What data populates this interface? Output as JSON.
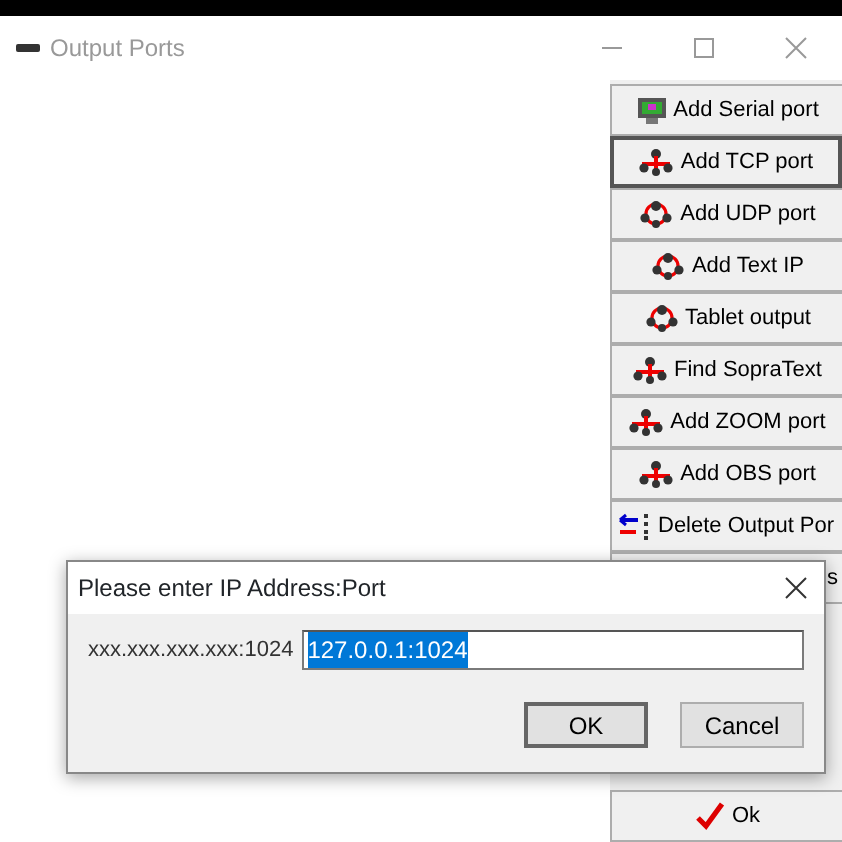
{
  "window": {
    "title": "Output Ports",
    "active": false
  },
  "buttons": [
    {
      "label": "Add Serial port",
      "kind": "serial",
      "focused": false
    },
    {
      "label": "Add TCP port",
      "kind": "network",
      "focused": true
    },
    {
      "label": "Add UDP port",
      "kind": "ring",
      "focused": false
    },
    {
      "label": "Add Text IP",
      "kind": "ring",
      "focused": false
    },
    {
      "label": "Tablet output",
      "kind": "ring",
      "focused": false
    },
    {
      "label": "Find SopraText",
      "kind": "network",
      "focused": false
    },
    {
      "label": "Add ZOOM port",
      "kind": "network",
      "focused": false
    },
    {
      "label": "Add OBS port",
      "kind": "network",
      "focused": false
    },
    {
      "label": "Delete Output Por",
      "kind": "delete",
      "focused": false
    },
    {
      "label": "s",
      "kind": "covered",
      "focused": false
    }
  ],
  "ok_button": {
    "label": "Ok"
  },
  "dialog": {
    "title": "Please enter IP Address:Port",
    "prompt": "xxx.xxx.xxx.xxx:1024",
    "field": {
      "value": "127.0.0.1:1024",
      "selected": true
    },
    "buttons": [
      {
        "label": "OK",
        "default": true
      },
      {
        "label": "Cancel",
        "default": false
      }
    ]
  }
}
